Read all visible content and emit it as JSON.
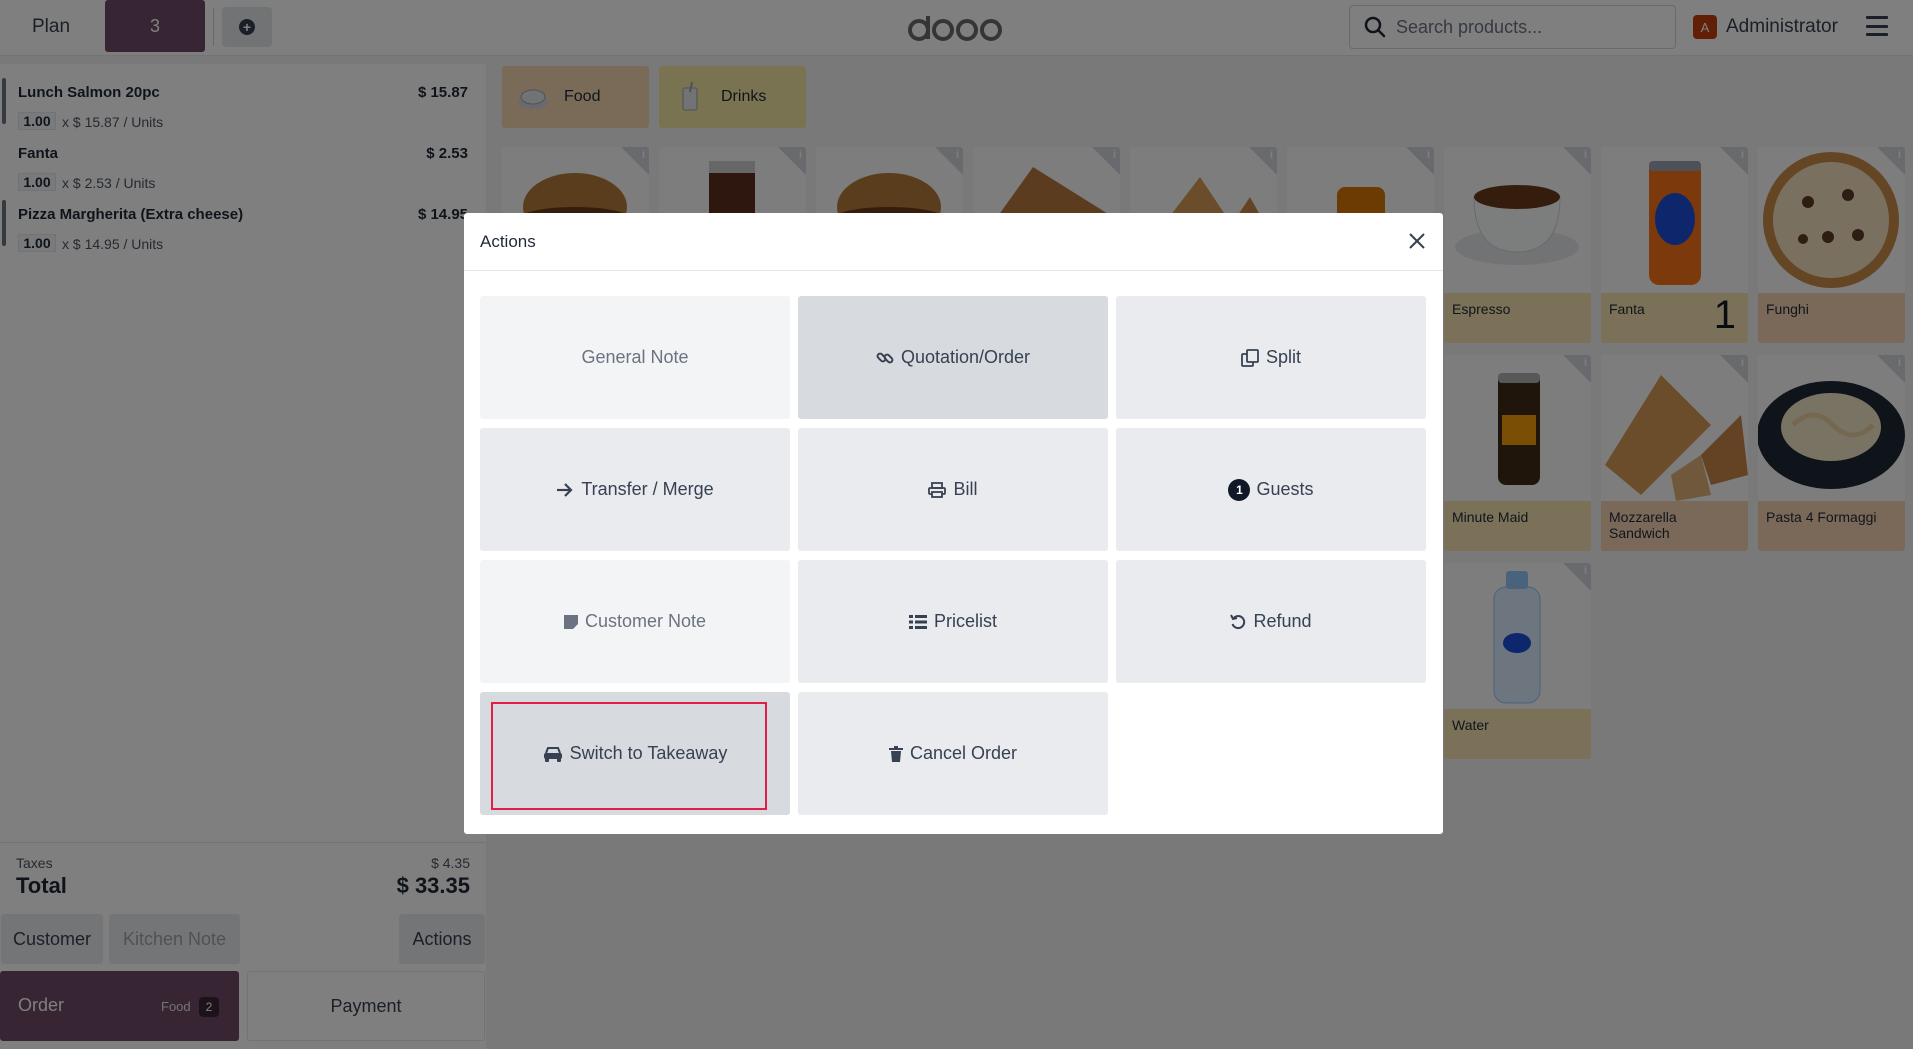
{
  "topbar": {
    "plan_label": "Plan",
    "table_number": "3",
    "search_placeholder": "Search products...",
    "user_initial": "A",
    "user_name": "Administrator"
  },
  "order": {
    "lines": [
      {
        "name": "Lunch Salmon 20pc",
        "price": "$ 15.87",
        "qty": "1.00",
        "unit": "x $ 15.87 / Units"
      },
      {
        "name": "Fanta",
        "price": "$ 2.53",
        "qty": "1.00",
        "unit": "x $ 2.53 / Units"
      },
      {
        "name": "Pizza Margherita (Extra cheese)",
        "price": "$ 14.95",
        "qty": "1.00",
        "unit": "x $ 14.95 / Units"
      }
    ],
    "taxes_label": "Taxes",
    "taxes_value": "$ 4.35",
    "total_label": "Total",
    "total_value": "$ 33.35"
  },
  "controls": {
    "customer": "Customer",
    "kitchen_note": "Kitchen Note",
    "actions": "Actions",
    "order": "Order",
    "order_sub": "Food",
    "order_badge": "2",
    "payment": "Payment"
  },
  "categories": [
    {
      "label": "Food",
      "color": "#f5d7b3"
    },
    {
      "label": "Drinks",
      "color": "#f5e6a3"
    }
  ],
  "products": [
    {
      "name": "Espresso",
      "color": "#f4e3b0"
    },
    {
      "name": "Fanta",
      "color": "#f4e3b0",
      "qty": "1"
    },
    {
      "name": "Funghi",
      "color": "#f5d3b3"
    },
    {
      "name": "Minute Maid",
      "color": "#f4e3b0"
    },
    {
      "name": "Mozzarella Sandwich",
      "color": "#f5d3b3"
    },
    {
      "name": "Pasta 4 Formaggi",
      "color": "#f5d3b3"
    },
    {
      "name": "Water",
      "color": "#f4e3b0"
    }
  ],
  "modal": {
    "title": "Actions",
    "buttons": {
      "general_note": "General Note",
      "quotation_order": "Quotation/Order",
      "split": "Split",
      "transfer_merge": "Transfer / Merge",
      "bill": "Bill",
      "guests": "Guests",
      "guests_count": "1",
      "customer_note": "Customer Note",
      "pricelist": "Pricelist",
      "refund": "Refund",
      "switch_takeaway": "Switch to Takeaway",
      "cancel_order": "Cancel Order"
    }
  },
  "colors": {
    "brand": "#714b67",
    "highlight": "#e11d48"
  }
}
